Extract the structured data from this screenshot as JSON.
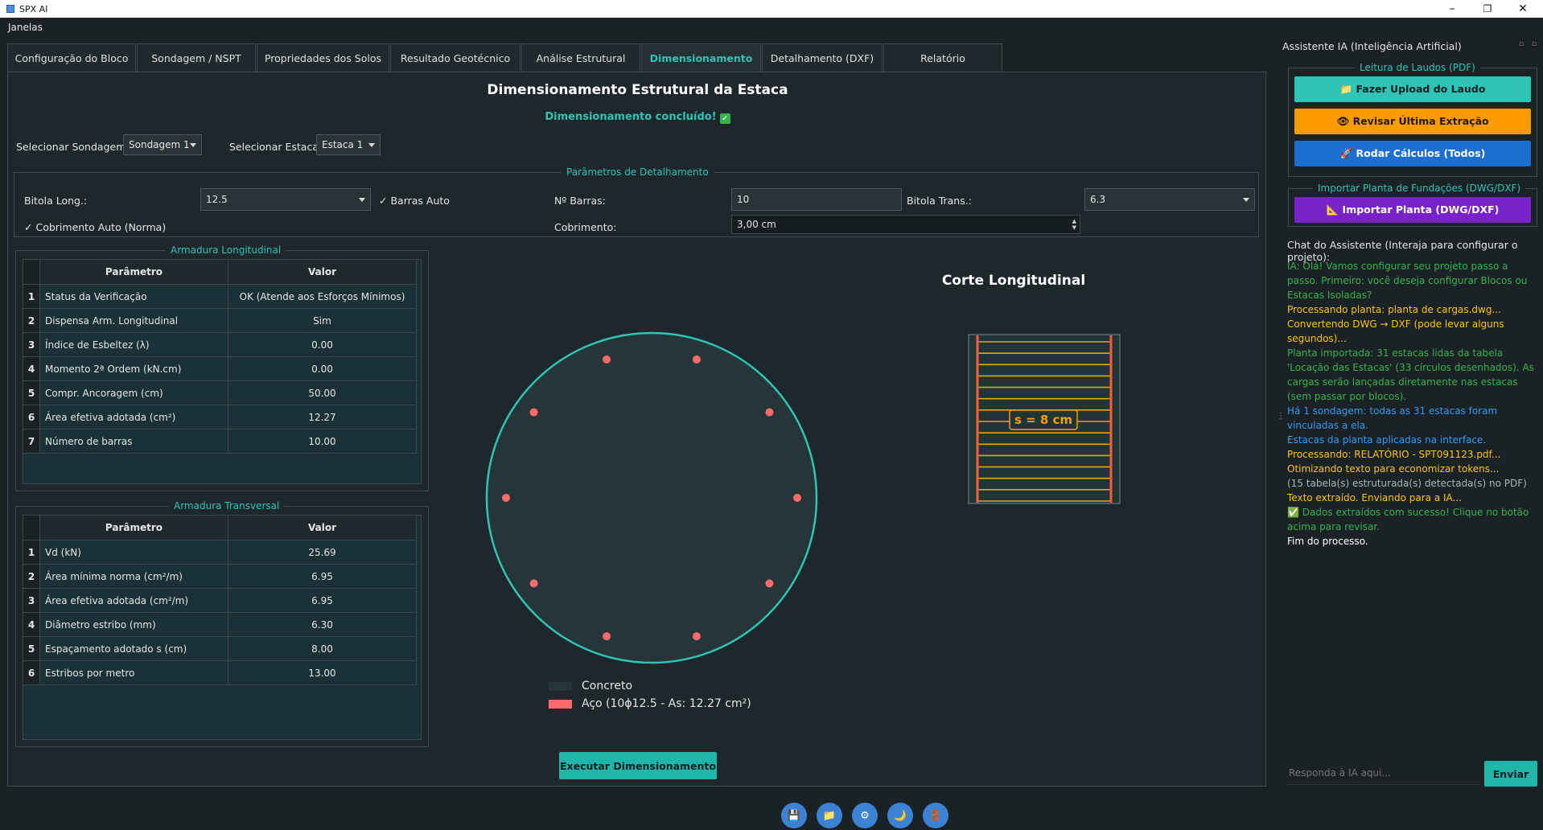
{
  "window": {
    "title": "SPX AI",
    "minimize": "–",
    "restore": "❐",
    "close": "✕"
  },
  "menu": {
    "label": "Janelas"
  },
  "tabs": [
    {
      "label": "Configuração do Bloco",
      "active": false
    },
    {
      "label": "Sondagem / NSPT",
      "active": false
    },
    {
      "label": "Propriedades dos Solos",
      "active": false
    },
    {
      "label": "Resultado Geotécnico",
      "active": false
    },
    {
      "label": "Análise Estrutural",
      "active": false
    },
    {
      "label": "Dimensionamento",
      "active": true
    },
    {
      "label": "Detalhamento (DXF)",
      "active": false
    },
    {
      "label": "Relatório",
      "active": false
    }
  ],
  "main": {
    "title": "Dimensionamento Estrutural da Estaca",
    "status": "Dimensionamento concluído!",
    "status_icon": "✓",
    "select_sondagem_label": "Selecionar Sondagem:",
    "select_sondagem_value": "Sondagem 1",
    "select_estaca_label": "Selecionar Estaca:",
    "select_estaca_value": "Estaca 1"
  },
  "params": {
    "group_title": "Parâmetros de Detalhamento",
    "bitola_long_label": "Bitola Long.:",
    "bitola_long_value": "12.5",
    "barras_auto_label": "Barras Auto",
    "barras_auto_checked": true,
    "n_barras_label": "Nº Barras:",
    "n_barras_value": "10",
    "bitola_trans_label": "Bitola Trans.:",
    "bitola_trans_value": "6.3",
    "cobrimento_auto_label": "Cobrimento Auto (Norma)",
    "cobrimento_auto_checked": true,
    "cobrimento_label": "Cobrimento:",
    "cobrimento_value": "3,00 cm",
    "check_glyph": "✓"
  },
  "long_table": {
    "group_title": "Armadura Longitudinal",
    "headers": [
      "Parâmetro",
      "Valor"
    ],
    "rows": [
      {
        "n": "1",
        "p": "Status da Verificação",
        "v": "OK (Atende aos Esforços Mínimos)"
      },
      {
        "n": "2",
        "p": "Dispensa Arm. Longitudinal",
        "v": "Sim"
      },
      {
        "n": "3",
        "p": "Índice de Esbeltez (λ)",
        "v": "0.00"
      },
      {
        "n": "4",
        "p": "Momento 2ª Ordem (kN.cm)",
        "v": "0.00"
      },
      {
        "n": "5",
        "p": "Compr. Ancoragem (cm)",
        "v": "50.00"
      },
      {
        "n": "6",
        "p": "Área efetiva adotada (cm²)",
        "v": "12.27"
      },
      {
        "n": "7",
        "p": "Número de barras",
        "v": "10.00"
      }
    ]
  },
  "trans_table": {
    "group_title": "Armadura Transversal",
    "headers": [
      "Parâmetro",
      "Valor"
    ],
    "rows": [
      {
        "n": "1",
        "p": "Vd (kN)",
        "v": "25.69"
      },
      {
        "n": "2",
        "p": "Área mínima norma (cm²/m)",
        "v": "6.95"
      },
      {
        "n": "3",
        "p": "Área efetiva adotada (cm²/m)",
        "v": "6.95"
      },
      {
        "n": "4",
        "p": "Diâmetro estribo (mm)",
        "v": "6.30"
      },
      {
        "n": "5",
        "p": "Espaçamento adotado s (cm)",
        "v": "8.00"
      },
      {
        "n": "6",
        "p": "Estribos por metro",
        "v": "13.00"
      }
    ]
  },
  "section": {
    "bar_count": 10,
    "legend_concrete": "Concreto",
    "legend_steel": "Aço (10ϕ12.5 - As: 12.27 cm²)",
    "concrete_color": "#253538",
    "steel_color": "#ff6b6b",
    "edge_color": "#2ec4b6"
  },
  "longitudinal": {
    "title": "Corte Longitudinal",
    "spacing_label": "s = 8 cm",
    "stirrup_count": 15,
    "stirrup_color": "#f59f00",
    "bar_color": "#ff5a3c"
  },
  "execute_button": "Executar Dimensionamento",
  "assistant": {
    "title": "Assistente IA (Inteligência Artificial)",
    "laudos_group": "Leitura de Laudos (PDF)",
    "upload_button": "📁 Fazer Upload do Laudo",
    "review_button": "👁 Revisar Última Extração",
    "run_button": "🚀 Rodar Cálculos (Todos)",
    "import_group": "Importar Planta de Fundações (DWG/DXF)",
    "import_button": "📐 Importar Planta (DWG/DXF)",
    "chat_label": "Chat do Assistente (Interaja para configurar o projeto):",
    "messages": [
      {
        "text": "IA: Olá! Vamos configurar seu projeto passo a passo. Primeiro: você deseja configurar Blocos ou Estacas Isoladas?",
        "color": "#37b24d"
      },
      {
        "text": "Processando planta: planta de cargas.dwg...",
        "color": "#fcc419"
      },
      {
        "text": "Convertendo DWG → DXF (pode levar alguns segundos)...",
        "color": "#fcc419"
      },
      {
        "text": "Planta importada: 31 estacas lidas da tabela 'Locação das Estacas' (33 círculos desenhados). As cargas serão lançadas diretamente nas estacas (sem passar por blocos).",
        "color": "#37b24d"
      },
      {
        "text": "Há 1 sondagem: todas as 31 estacas foram vinculadas a ela.",
        "color": "#339af0"
      },
      {
        "text": "Estacas da planta aplicadas na interface.",
        "color": "#339af0"
      },
      {
        "text": "Processando: RELATÓRIO - SPT091123.pdf...",
        "color": "#fcc419"
      },
      {
        "text": "Otimizando texto para economizar tokens...",
        "color": "#fcc419"
      },
      {
        "text": "(15 tabela(s) estruturada(s) detectada(s) no PDF)",
        "color": "#adb5bd"
      },
      {
        "text": "Texto extraído. Enviando para a IA...",
        "color": "#fcc419"
      },
      {
        "text": "✅ Dados extraídos com sucesso! Clique no botão acima para revisar.",
        "color": "#37b24d"
      },
      {
        "text": "Fim do processo.",
        "color": "#ffffff"
      }
    ],
    "input_placeholder": "Responda à IA aqui...",
    "send_button": "Enviar"
  },
  "bottom_icons": [
    {
      "name": "save-icon",
      "glyph": "💾"
    },
    {
      "name": "folder-icon",
      "glyph": "📁"
    },
    {
      "name": "settings-icon",
      "glyph": "⚙"
    },
    {
      "name": "moon-icon",
      "glyph": "🌙"
    },
    {
      "name": "exit-icon",
      "glyph": "🚪"
    }
  ]
}
